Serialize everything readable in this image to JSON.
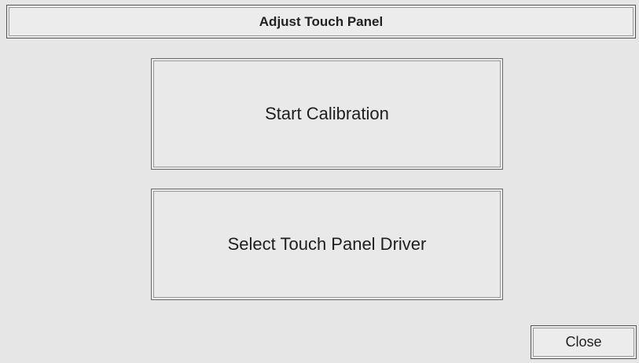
{
  "window": {
    "title": "Adjust Touch Panel"
  },
  "main": {
    "start_calibration_label": "Start Calibration",
    "select_driver_label": "Select Touch Panel Driver"
  },
  "footer": {
    "close_label": "Close"
  }
}
